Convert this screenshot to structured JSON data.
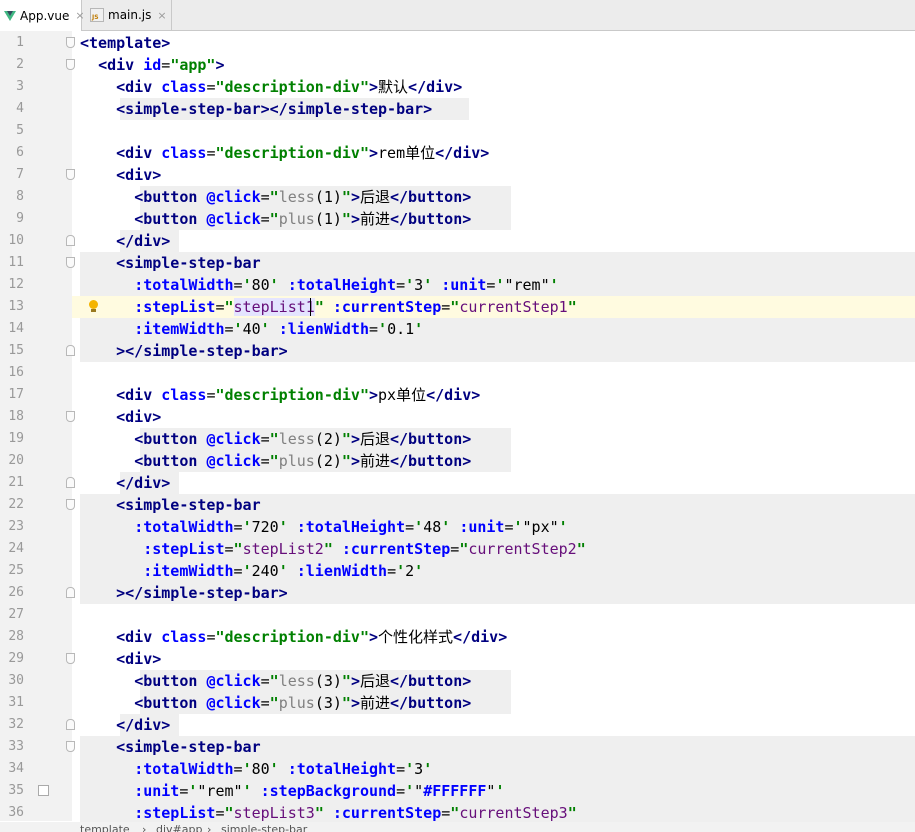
{
  "tabs": [
    {
      "label": "App.vue",
      "icon": "vue-file-icon",
      "active": true
    },
    {
      "label": "main.js",
      "icon": "js-file-icon",
      "active": false
    }
  ],
  "close_glyph": "×",
  "lines": [
    {
      "n": "1",
      "tokens": [
        [
          "t",
          "<template>"
        ]
      ]
    },
    {
      "n": "2",
      "tokens": [
        [
          "",
          "  "
        ],
        [
          "t",
          "<div "
        ],
        [
          "a",
          "id"
        ],
        [
          "",
          "="
        ],
        [
          "s",
          "\"app\""
        ],
        [
          "t",
          ">"
        ]
      ]
    },
    {
      "n": "3",
      "tokens": [
        [
          "",
          "    "
        ],
        [
          "t",
          "<div "
        ],
        [
          "a",
          "class"
        ],
        [
          "",
          "="
        ],
        [
          "s",
          "\"description-div\""
        ],
        [
          "t",
          ">"
        ],
        [
          "",
          "默认"
        ],
        [
          "t",
          "</div>"
        ]
      ]
    },
    {
      "n": "4",
      "tokens": [
        [
          "",
          "    "
        ],
        [
          "t",
          "<simple-step-bar></simple-step-bar>"
        ]
      ]
    },
    {
      "n": "5",
      "tokens": []
    },
    {
      "n": "6",
      "tokens": [
        [
          "",
          "    "
        ],
        [
          "t",
          "<div "
        ],
        [
          "a",
          "class"
        ],
        [
          "",
          "="
        ],
        [
          "s",
          "\"description-div\""
        ],
        [
          "t",
          ">"
        ],
        [
          "",
          "rem单位"
        ],
        [
          "t",
          "</div>"
        ]
      ]
    },
    {
      "n": "7",
      "tokens": [
        [
          "",
          "    "
        ],
        [
          "t",
          "<div>"
        ]
      ]
    },
    {
      "n": "8",
      "tokens": [
        [
          "",
          "      "
        ],
        [
          "t",
          "<button "
        ],
        [
          "a",
          "@click"
        ],
        [
          "",
          "="
        ],
        [
          "s",
          "\""
        ],
        [
          "k",
          "less"
        ],
        [
          "",
          "(1)"
        ],
        [
          "s",
          "\""
        ],
        [
          "t",
          ">"
        ],
        [
          "",
          "后退"
        ],
        [
          "t",
          "</button>"
        ]
      ]
    },
    {
      "n": "9",
      "tokens": [
        [
          "",
          "      "
        ],
        [
          "t",
          "<button "
        ],
        [
          "a",
          "@click"
        ],
        [
          "",
          "="
        ],
        [
          "s",
          "\""
        ],
        [
          "k",
          "plus"
        ],
        [
          "",
          "(1)"
        ],
        [
          "s",
          "\""
        ],
        [
          "t",
          ">"
        ],
        [
          "",
          "前进"
        ],
        [
          "t",
          "</button>"
        ]
      ]
    },
    {
      "n": "10",
      "tokens": [
        [
          "",
          "    "
        ],
        [
          "t",
          "</div>"
        ]
      ]
    },
    {
      "n": "11",
      "tokens": [
        [
          "",
          "    "
        ],
        [
          "t",
          "<simple-step-bar"
        ]
      ]
    },
    {
      "n": "12",
      "tokens": [
        [
          "",
          "      "
        ],
        [
          "a",
          ":totalWidth"
        ],
        [
          "",
          "="
        ],
        [
          "s",
          "'"
        ],
        [
          "",
          "80"
        ],
        [
          "s",
          "' "
        ],
        [
          "a",
          ":totalHeight"
        ],
        [
          "",
          "="
        ],
        [
          "s",
          "'"
        ],
        [
          "",
          "3"
        ],
        [
          "s",
          "' "
        ],
        [
          "a",
          ":unit"
        ],
        [
          "",
          "="
        ],
        [
          "s",
          "'"
        ],
        [
          "",
          "\"rem\""
        ],
        [
          "s",
          "'"
        ]
      ]
    },
    {
      "n": "13",
      "tokens": [
        [
          "",
          "      "
        ],
        [
          "a",
          ":stepList"
        ],
        [
          "",
          "="
        ],
        [
          "s",
          "\""
        ],
        [
          "p",
          "stepList1"
        ],
        [
          "s",
          "\" "
        ],
        [
          "a",
          ":currentStep"
        ],
        [
          "",
          "="
        ],
        [
          "s",
          "\""
        ],
        [
          "p",
          "currentStep1"
        ],
        [
          "s",
          "\""
        ]
      ]
    },
    {
      "n": "14",
      "tokens": [
        [
          "",
          "      "
        ],
        [
          "a",
          ":itemWidth"
        ],
        [
          "",
          "="
        ],
        [
          "s",
          "'"
        ],
        [
          "",
          "40"
        ],
        [
          "s",
          "' "
        ],
        [
          "a",
          ":lienWidth"
        ],
        [
          "",
          "="
        ],
        [
          "s",
          "'"
        ],
        [
          "",
          "0.1"
        ],
        [
          "s",
          "'"
        ]
      ]
    },
    {
      "n": "15",
      "tokens": [
        [
          "",
          "    "
        ],
        [
          "t",
          "></simple-step-bar>"
        ]
      ]
    },
    {
      "n": "16",
      "tokens": []
    },
    {
      "n": "17",
      "tokens": [
        [
          "",
          "    "
        ],
        [
          "t",
          "<div "
        ],
        [
          "a",
          "class"
        ],
        [
          "",
          "="
        ],
        [
          "s",
          "\"description-div\""
        ],
        [
          "t",
          ">"
        ],
        [
          "",
          "px单位"
        ],
        [
          "t",
          "</div>"
        ]
      ]
    },
    {
      "n": "18",
      "tokens": [
        [
          "",
          "    "
        ],
        [
          "t",
          "<div>"
        ]
      ]
    },
    {
      "n": "19",
      "tokens": [
        [
          "",
          "      "
        ],
        [
          "t",
          "<button "
        ],
        [
          "a",
          "@click"
        ],
        [
          "",
          "="
        ],
        [
          "s",
          "\""
        ],
        [
          "k",
          "less"
        ],
        [
          "",
          "(2)"
        ],
        [
          "s",
          "\""
        ],
        [
          "t",
          ">"
        ],
        [
          "",
          "后退"
        ],
        [
          "t",
          "</button>"
        ]
      ]
    },
    {
      "n": "20",
      "tokens": [
        [
          "",
          "      "
        ],
        [
          "t",
          "<button "
        ],
        [
          "a",
          "@click"
        ],
        [
          "",
          "="
        ],
        [
          "s",
          "\""
        ],
        [
          "k",
          "plus"
        ],
        [
          "",
          "(2)"
        ],
        [
          "s",
          "\""
        ],
        [
          "t",
          ">"
        ],
        [
          "",
          "前进"
        ],
        [
          "t",
          "</button>"
        ]
      ]
    },
    {
      "n": "21",
      "tokens": [
        [
          "",
          "    "
        ],
        [
          "t",
          "</div>"
        ]
      ]
    },
    {
      "n": "22",
      "tokens": [
        [
          "",
          "    "
        ],
        [
          "t",
          "<simple-step-bar"
        ]
      ]
    },
    {
      "n": "23",
      "tokens": [
        [
          "",
          "      "
        ],
        [
          "a",
          ":totalWidth"
        ],
        [
          "",
          "="
        ],
        [
          "s",
          "'"
        ],
        [
          "",
          "720"
        ],
        [
          "s",
          "' "
        ],
        [
          "a",
          ":totalHeight"
        ],
        [
          "",
          "="
        ],
        [
          "s",
          "'"
        ],
        [
          "",
          "48"
        ],
        [
          "s",
          "' "
        ],
        [
          "a",
          ":unit"
        ],
        [
          "",
          "="
        ],
        [
          "s",
          "'"
        ],
        [
          "",
          "\"px\""
        ],
        [
          "s",
          "'"
        ]
      ]
    },
    {
      "n": "24",
      "tokens": [
        [
          "",
          "       "
        ],
        [
          "a",
          ":stepList"
        ],
        [
          "",
          "="
        ],
        [
          "s",
          "\""
        ],
        [
          "p",
          "stepList2"
        ],
        [
          "s",
          "\" "
        ],
        [
          "a",
          ":currentStep"
        ],
        [
          "",
          "="
        ],
        [
          "s",
          "\""
        ],
        [
          "p",
          "currentStep2"
        ],
        [
          "s",
          "\""
        ]
      ]
    },
    {
      "n": "25",
      "tokens": [
        [
          "",
          "       "
        ],
        [
          "a",
          ":itemWidth"
        ],
        [
          "",
          "="
        ],
        [
          "s",
          "'"
        ],
        [
          "",
          "240"
        ],
        [
          "s",
          "' "
        ],
        [
          "a",
          ":lienWidth"
        ],
        [
          "",
          "="
        ],
        [
          "s",
          "'"
        ],
        [
          "",
          "2"
        ],
        [
          "s",
          "'"
        ]
      ]
    },
    {
      "n": "26",
      "tokens": [
        [
          "",
          "    "
        ],
        [
          "t",
          "></simple-step-bar>"
        ]
      ]
    },
    {
      "n": "27",
      "tokens": []
    },
    {
      "n": "28",
      "tokens": [
        [
          "",
          "    "
        ],
        [
          "t",
          "<div "
        ],
        [
          "a",
          "class"
        ],
        [
          "",
          "="
        ],
        [
          "s",
          "\"description-div\""
        ],
        [
          "t",
          ">"
        ],
        [
          "",
          "个性化样式"
        ],
        [
          "t",
          "</div>"
        ]
      ]
    },
    {
      "n": "29",
      "tokens": [
        [
          "",
          "    "
        ],
        [
          "t",
          "<div>"
        ]
      ]
    },
    {
      "n": "30",
      "tokens": [
        [
          "",
          "      "
        ],
        [
          "t",
          "<button "
        ],
        [
          "a",
          "@click"
        ],
        [
          "",
          "="
        ],
        [
          "s",
          "\""
        ],
        [
          "k",
          "less"
        ],
        [
          "",
          "(3)"
        ],
        [
          "s",
          "\""
        ],
        [
          "t",
          ">"
        ],
        [
          "",
          "后退"
        ],
        [
          "t",
          "</button>"
        ]
      ]
    },
    {
      "n": "31",
      "tokens": [
        [
          "",
          "      "
        ],
        [
          "t",
          "<button "
        ],
        [
          "a",
          "@click"
        ],
        [
          "",
          "="
        ],
        [
          "s",
          "\""
        ],
        [
          "k",
          "plus"
        ],
        [
          "",
          "(3)"
        ],
        [
          "s",
          "\""
        ],
        [
          "t",
          ">"
        ],
        [
          "",
          "前进"
        ],
        [
          "t",
          "</button>"
        ]
      ]
    },
    {
      "n": "32",
      "tokens": [
        [
          "",
          "    "
        ],
        [
          "t",
          "</div>"
        ]
      ]
    },
    {
      "n": "33",
      "tokens": [
        [
          "",
          "    "
        ],
        [
          "t",
          "<simple-step-bar"
        ]
      ]
    },
    {
      "n": "34",
      "tokens": [
        [
          "",
          "      "
        ],
        [
          "a",
          ":totalWidth"
        ],
        [
          "",
          "="
        ],
        [
          "s",
          "'"
        ],
        [
          "",
          "80"
        ],
        [
          "s",
          "' "
        ],
        [
          "a",
          ":totalHeight"
        ],
        [
          "",
          "="
        ],
        [
          "s",
          "'"
        ],
        [
          "",
          "3"
        ],
        [
          "s",
          "'"
        ]
      ]
    },
    {
      "n": "35",
      "tokens": [
        [
          "",
          "      "
        ],
        [
          "a",
          ":unit"
        ],
        [
          "",
          "="
        ],
        [
          "s",
          "'"
        ],
        [
          "",
          "\"rem\""
        ],
        [
          "s",
          "' "
        ],
        [
          "a",
          ":stepBackground"
        ],
        [
          "",
          "="
        ],
        [
          "s",
          "'"
        ],
        [
          "",
          "\""
        ],
        [
          "a",
          "#FFFFFF"
        ],
        [
          "",
          "\""
        ],
        [
          "s",
          "'"
        ]
      ]
    },
    {
      "n": "36",
      "tokens": [
        [
          "",
          "      "
        ],
        [
          "a",
          ":stepList"
        ],
        [
          "",
          "="
        ],
        [
          "s",
          "\""
        ],
        [
          "p",
          "stepList3"
        ],
        [
          "s",
          "\" "
        ],
        [
          "a",
          ":currentStep"
        ],
        [
          "",
          "="
        ],
        [
          "s",
          "\""
        ],
        [
          "p",
          "currentStep3"
        ],
        [
          "s",
          "\""
        ]
      ]
    }
  ],
  "breadcrumb": [
    "template",
    "div#app",
    "simple-step-bar"
  ],
  "breadcrumb_separator": "›",
  "colors": {
    "tag": "#000080",
    "attr": "#0000ff",
    "string": "#008000",
    "prop": "#660e7a",
    "method": "#808080",
    "caret_line": "#fffbe0",
    "vue_icon": "#41b883"
  },
  "gutter_marks": [
    {
      "line": "13",
      "kind": "intention-bulb-icon"
    },
    {
      "line": "35",
      "kind": "bookmark-icon"
    }
  ],
  "fold_open_lines": [
    "1",
    "2",
    "7",
    "11",
    "18",
    "22",
    "29",
    "33"
  ],
  "fold_close_lines": [
    "10",
    "15",
    "21",
    "26",
    "32"
  ],
  "caret_line": "13",
  "highlighted_word": "stepList1"
}
